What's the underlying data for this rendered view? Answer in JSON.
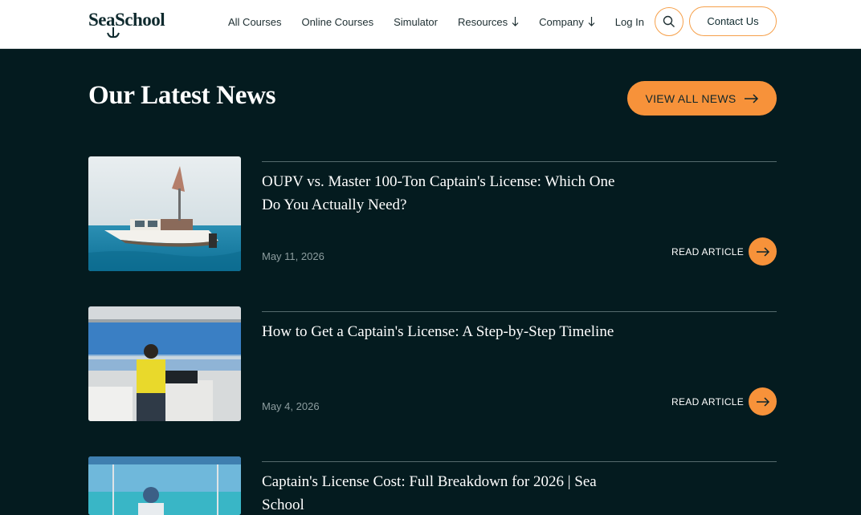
{
  "brand": {
    "logo_text": "SeaSchool"
  },
  "nav": [
    {
      "label": "All Courses"
    },
    {
      "label": "Online Courses"
    },
    {
      "label": "Simulator"
    },
    {
      "label": "Resources",
      "dropdown": true
    },
    {
      "label": "Company",
      "dropdown": true
    },
    {
      "label": "Log In"
    }
  ],
  "header": {
    "search_icon": "search-icon",
    "contact_label": "Contact Us"
  },
  "news": {
    "title": "Our Latest News",
    "view_all_label": "VIEW ALL NEWS",
    "read_label": "READ ARTICLE",
    "articles": [
      {
        "title": "OUPV vs. Master 100-Ton Captain's License: Which One Do You Actually Need?",
        "date": "May 11, 2026"
      },
      {
        "title": "How to Get a Captain's License: A Step-by-Step Timeline",
        "date": "May 4, 2026"
      },
      {
        "title": "Captain's License Cost: Full Breakdown for 2026 | Sea School",
        "date": ""
      }
    ]
  },
  "colors": {
    "accent": "#f7923a",
    "background": "#041b1f",
    "header_bg": "#ffffff"
  }
}
